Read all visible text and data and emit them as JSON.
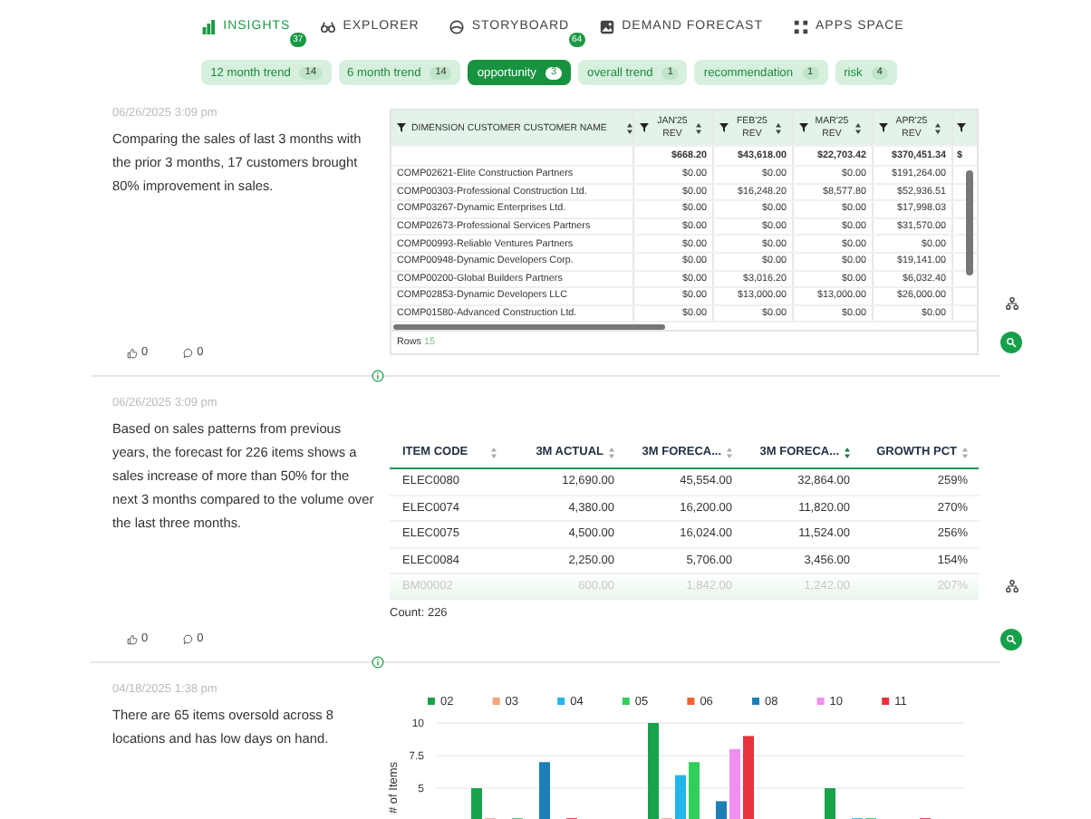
{
  "nav": [
    {
      "label": "INSIGHTS",
      "selected": true,
      "badge": "37"
    },
    {
      "label": "EXPLORER",
      "selected": false
    },
    {
      "label": "STORYBOARD",
      "selected": false,
      "badge": "64"
    },
    {
      "label": "DEMAND FORECAST",
      "selected": false
    },
    {
      "label": "APPS SPACE",
      "selected": false
    }
  ],
  "filters": [
    {
      "label": "12 month trend",
      "count": "14",
      "selected": false
    },
    {
      "label": "6 month trend",
      "count": "14",
      "selected": false
    },
    {
      "label": "opportunity",
      "count": "3",
      "selected": true
    },
    {
      "label": "overall trend",
      "count": "1",
      "selected": false
    },
    {
      "label": "recommendation",
      "count": "1",
      "selected": false
    },
    {
      "label": "risk",
      "count": "4",
      "selected": false
    }
  ],
  "insights": [
    {
      "kind": "pivot",
      "date": "06/26/2025 3:09 pm",
      "text": "Comparing the sales of last 3 months with the prior 3 months, 17 customers brought 80% improvement in sales.",
      "likes": "0",
      "comments": "0",
      "table": {
        "columns": [
          "DIMENSION CUSTOMER CUSTOMER NAME",
          "JAN'25 REV",
          "FEB'25 REV",
          "MAR'25 REV",
          "APR'25 REV"
        ],
        "totals": [
          "$668.20",
          "$43,618.00",
          "$22,703.42",
          "$370,451.34",
          "$"
        ],
        "rows": [
          [
            "COMP02621-Elite Construction Partners",
            "$0.00",
            "$0.00",
            "$0.00",
            "$191,264.00"
          ],
          [
            "COMP00303-Professional Construction Ltd.",
            "$0.00",
            "$16,248.20",
            "$8,577.80",
            "$52,936.51"
          ],
          [
            "COMP03267-Dynamic Enterprises Ltd.",
            "$0.00",
            "$0.00",
            "$0.00",
            "$17,998.03"
          ],
          [
            "COMP02673-Professional Services Partners",
            "$0.00",
            "$0.00",
            "$0.00",
            "$31,570.00"
          ],
          [
            "COMP00993-Reliable Ventures Partners",
            "$0.00",
            "$0.00",
            "$0.00",
            "$0.00"
          ],
          [
            "COMP00948-Dynamic Developers Corp.",
            "$0.00",
            "$0.00",
            "$0.00",
            "$19,141.00"
          ],
          [
            "COMP00200-Global Builders Partners",
            "$0.00",
            "$3,016.20",
            "$0.00",
            "$6,032.40"
          ],
          [
            "COMP02853-Dynamic Developers LLC",
            "$0.00",
            "$13,000.00",
            "$13,000.00",
            "$26,000.00"
          ],
          [
            "COMP01580-Advanced Construction Ltd.",
            "$0.00",
            "$0.00",
            "$0.00",
            "$0.00"
          ]
        ],
        "footer_label": "Rows",
        "footer_count": "15"
      }
    },
    {
      "kind": "grid",
      "date": "06/26/2025 3:09 pm",
      "text": "Based on sales patterns from previous years, the forecast for 226 items shows a sales increase of more than 50% for the next 3 months compared to the volume over the last three months.",
      "likes": "0",
      "comments": "0",
      "table": {
        "columns": [
          {
            "label": "ITEM CODE",
            "sorted": false
          },
          {
            "label": "3M ACTUAL",
            "sorted": false
          },
          {
            "label": "3M FORECA...",
            "sorted": false
          },
          {
            "label": "3M FORECA...",
            "sorted": true
          },
          {
            "label": "GROWTH PCT",
            "sorted": false
          }
        ],
        "rows": [
          [
            "ELEC0080",
            "12,690.00",
            "45,554.00",
            "32,864.00",
            "259%"
          ],
          [
            "ELEC0074",
            "4,380.00",
            "16,200.00",
            "11,820.00",
            "270%"
          ],
          [
            "ELEC0075",
            "4,500.00",
            "16,024.00",
            "11,524.00",
            "256%"
          ],
          [
            "ELEC0084",
            "2,250.00",
            "5,706.00",
            "3,456.00",
            "154%"
          ],
          [
            "BM00002",
            "600.00",
            "1,842.00",
            "1,242.00",
            "207%"
          ]
        ],
        "footer": "Count: 226"
      }
    },
    {
      "kind": "chart",
      "date": "04/18/2025 1:38 pm",
      "text": "There are 65 items oversold across 8 locations and has low days on hand.",
      "chart_data": {
        "type": "bar",
        "legend": "top",
        "ylabel": "# of Items",
        "ylim": [
          0,
          10
        ],
        "yticks": [
          5,
          7.5,
          10
        ],
        "series": [
          {
            "name": "02",
            "color": "#16a34a",
            "values": [
              5,
              10,
              5
            ]
          },
          {
            "name": "03",
            "color": "#f5a37e",
            "values": [
              2.7,
              2.7,
              null
            ]
          },
          {
            "name": "04",
            "color": "#22b5ec",
            "values": [
              null,
              6,
              2.7
            ]
          },
          {
            "name": "05",
            "color": "#2fcf5a",
            "values": [
              2.7,
              7,
              2.7
            ]
          },
          {
            "name": "06",
            "color": "#f2622e",
            "values": [
              null,
              null,
              null
            ]
          },
          {
            "name": "08",
            "color": "#1d7fb8",
            "values": [
              7,
              4,
              null
            ]
          },
          {
            "name": "10",
            "color": "#f18ef2",
            "values": [
              null,
              8,
              null
            ]
          },
          {
            "name": "11",
            "color": "#e8323f",
            "values": [
              2.7,
              9,
              2.7
            ]
          }
        ]
      }
    }
  ]
}
